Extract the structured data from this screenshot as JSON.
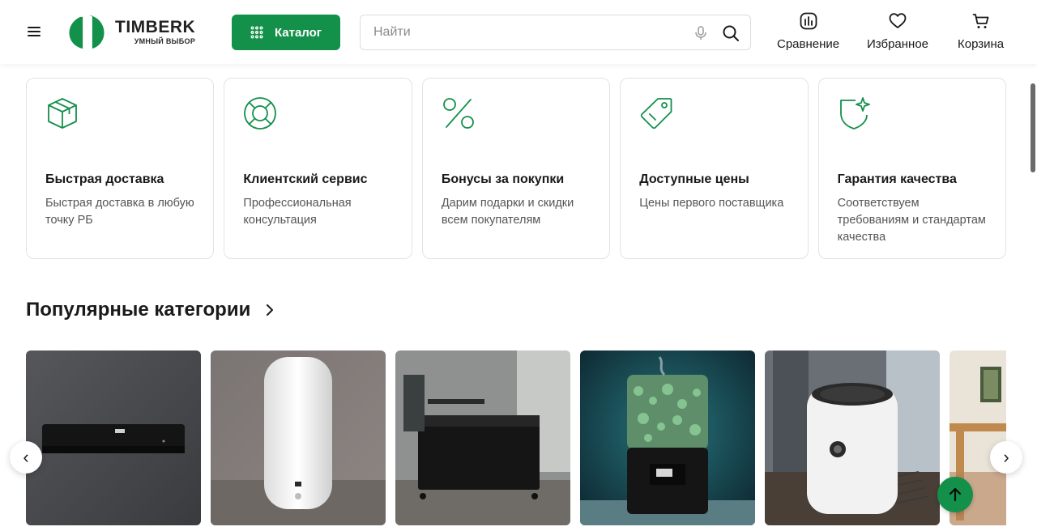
{
  "brand": {
    "name": "TIMBERK",
    "slogan": "УМНЫЙ ВЫБОР",
    "accent_color": "#13904a"
  },
  "header": {
    "catalog_label": "Каталог",
    "search_placeholder": "Найти",
    "actions": [
      {
        "label": "Сравнение",
        "icon": "compare-chart-icon"
      },
      {
        "label": "Избранное",
        "icon": "heart-icon"
      },
      {
        "label": "Корзина",
        "icon": "cart-icon"
      }
    ]
  },
  "features": [
    {
      "title": "Быстрая доставка",
      "desc": "Быстрая доставка в любую точку РБ",
      "icon": "box-icon"
    },
    {
      "title": "Клиентский сервис",
      "desc": "Профессиональная консультация",
      "icon": "lifebuoy-icon"
    },
    {
      "title": "Бонусы за покупки",
      "desc": "Дарим подарки и скидки всем покупателям",
      "icon": "percent-icon"
    },
    {
      "title": "Доступные цены",
      "desc": "Цены первого поставщика",
      "icon": "price-tag-icon"
    },
    {
      "title": "Гарантия качества",
      "desc": "Соответствуем требованиям и стандартам качества",
      "icon": "shield-star-icon"
    }
  ],
  "popular": {
    "title": "Популярные категории",
    "categories": [
      {
        "icon": "air-conditioner-image"
      },
      {
        "icon": "water-heater-image"
      },
      {
        "icon": "convector-heater-image"
      },
      {
        "icon": "humidifier-image"
      },
      {
        "icon": "air-purifier-image"
      },
      {
        "icon": "interior-image"
      }
    ]
  },
  "nav": {
    "prev": "‹",
    "next": "›"
  }
}
